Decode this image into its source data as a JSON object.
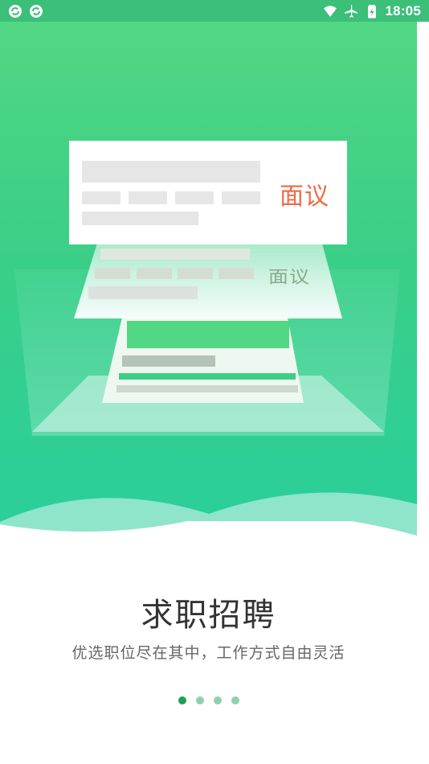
{
  "status_bar": {
    "left_icons": [
      "sync-icon",
      "sync-icon"
    ],
    "right_icons": [
      "wifi-icon",
      "airplane-mode-icon",
      "battery-icon"
    ],
    "time": "18:05"
  },
  "illustration": {
    "card_label": "面议",
    "card_label_reflection": "面议"
  },
  "onboarding": {
    "title": "求职招聘",
    "subtitle": "优选职位尽在其中，工作方式自由灵活"
  },
  "pager": {
    "total": 4,
    "active_index": 0
  },
  "colors": {
    "status_bar": "#3bbf79",
    "gradient_top": "#52d784",
    "gradient_bottom": "#29cf9b",
    "accent": "#ef6a46",
    "dot_active": "#1d9e55",
    "dot_inactive": "#8fd1ad"
  }
}
